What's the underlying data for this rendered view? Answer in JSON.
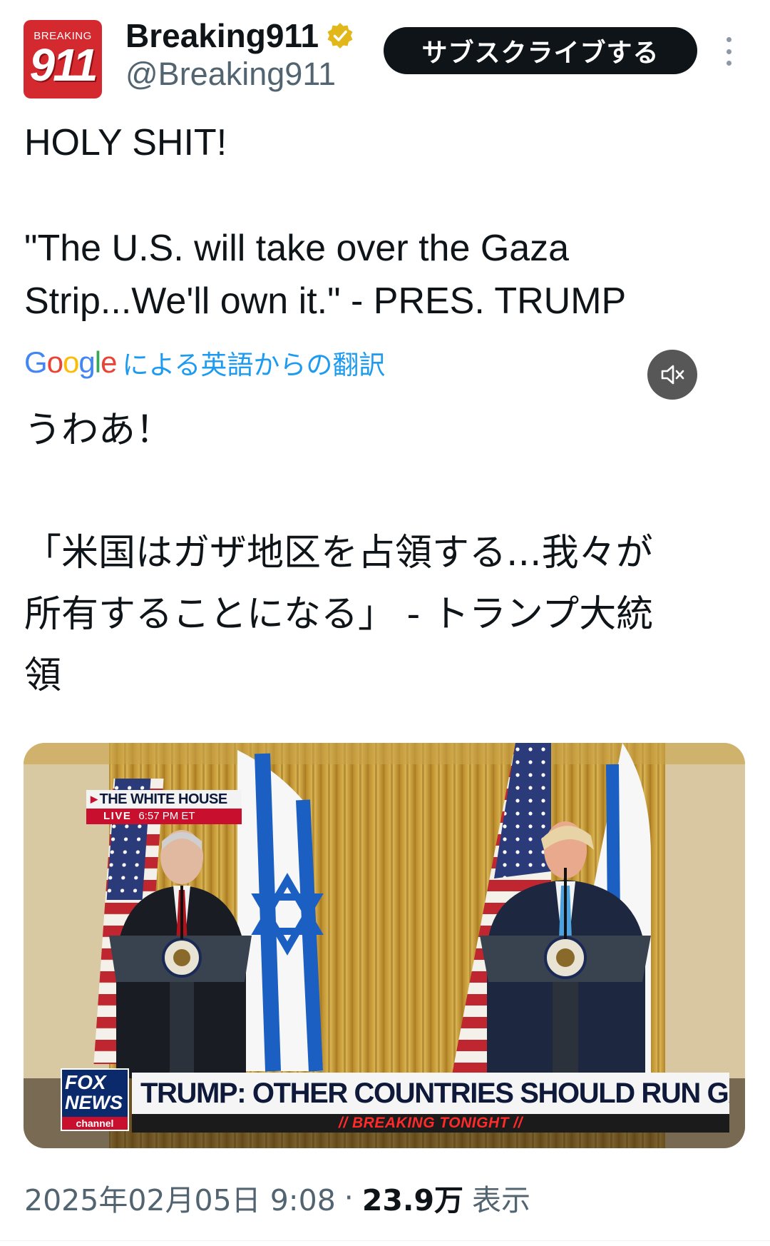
{
  "account": {
    "avatar_top_text": "BREAKING",
    "avatar_number": "911",
    "display_name": "Breaking911",
    "handle": "@Breaking911",
    "verified_icon": "verified-badge-gold"
  },
  "actions": {
    "subscribe_label": "サブスクライブする",
    "more_icon": "more-vertical-icon"
  },
  "tweet": {
    "text_lines": [
      "HOLY SHIT!",
      "",
      "\"The U.S. will take over the Gaza",
      "Strip...We'll own it.\" - PRES. TRUMP"
    ]
  },
  "translation": {
    "provider": "Google",
    "label": "による英語からの翻訳",
    "text_lines": [
      "うわあ！",
      "",
      "「米国はガザ地区を占領する...我々が",
      "所有することになる」 - トランプ大統",
      "領"
    ]
  },
  "media": {
    "live_location": "THE WHITE HOUSE",
    "live_label": "LIVE",
    "live_time": "6:57 PM ET",
    "network_line1": "FOX",
    "network_line2": "NEWS",
    "network_line3": "channel",
    "headline": "TRUMP: OTHER COUNTRIES SHOULD RUN GAZA",
    "subheadline": "// BREAKING TONIGHT //",
    "mute_icon": "speaker-muted-icon"
  },
  "meta": {
    "date": "2025年02月05日 9:08",
    "separator": "·",
    "views_count": "23.9万",
    "views_label": "表示"
  },
  "colors": {
    "text": "#0f1419",
    "secondary": "#536471",
    "link": "#1d9bf0",
    "button_bg": "#0f1419",
    "avatar_red": "#d42a2f",
    "verified_gold": "#e2b719"
  }
}
